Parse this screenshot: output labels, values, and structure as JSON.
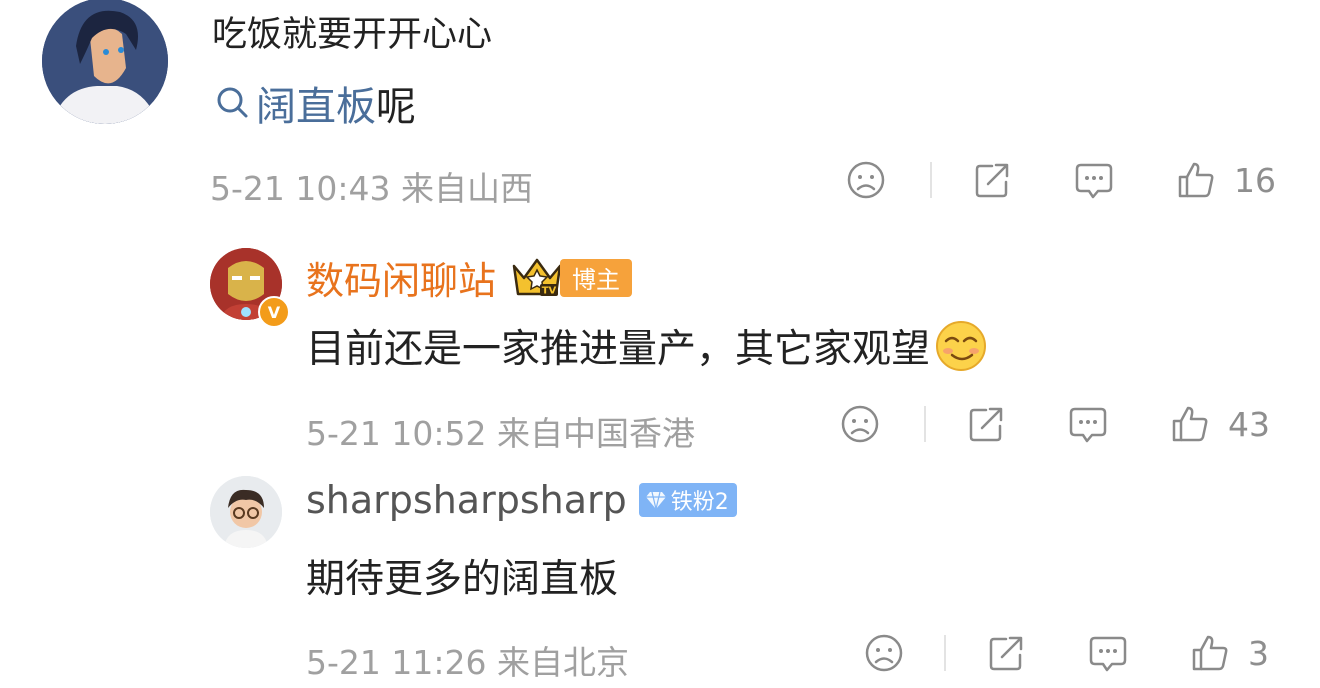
{
  "comment1": {
    "text": "吃饭就要开开心心",
    "search_topic": "阔直板",
    "search_suffix": "呢",
    "meta": "5-21 10:43  来自山西",
    "likes": "16"
  },
  "reply1": {
    "username": "数码闲聊站",
    "badge": "博主",
    "text": "目前还是一家推进量产，其它家观望",
    "meta": "5-21 10:52  来自中国香港",
    "likes": "43"
  },
  "reply2": {
    "username": "sharpsharpsharp",
    "badge": "铁粉2",
    "text": "期待更多的阔直板",
    "meta": "5-21 11:26  来自北京",
    "likes": "3"
  },
  "colors": {
    "username_orange": "#e8731d",
    "link_blue": "#4a6e9a",
    "meta_gray": "#9a9a9a"
  }
}
